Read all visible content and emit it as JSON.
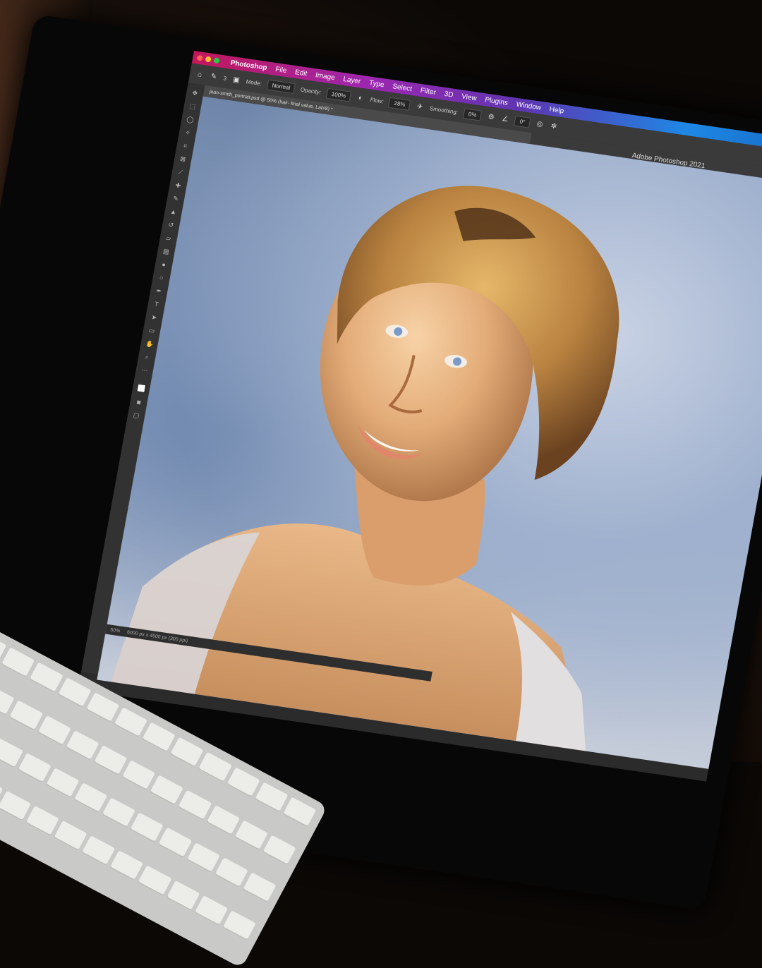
{
  "menubar": {
    "app": "Photoshop",
    "items": [
      "File",
      "Edit",
      "Image",
      "Layer",
      "Type",
      "Select",
      "Filter",
      "3D",
      "View",
      "Plugins",
      "Window",
      "Help"
    ]
  },
  "options": {
    "brush_size": "3",
    "mode_label": "Mode:",
    "mode_value": "Normal",
    "opacity_label": "Opacity:",
    "opacity_value": "100%",
    "flow_label": "Flow:",
    "flow_value": "28%",
    "smoothing_label": "Smoothing:",
    "smoothing_value": "0%",
    "angle_value": "0°"
  },
  "window_title": "Adobe Photoshop 2021",
  "document_tab": "jean-smith_portrait.psd @ 50% (hair- final value, Lab/8) *",
  "statusbar": {
    "zoom": "50%",
    "dimensions": "6000 px x 4500 px (300 ppi)"
  },
  "colors": {
    "accent_start": "#c2185b",
    "accent_end": "#1565c0",
    "ui_dark": "#2b2b2b"
  },
  "tools": [
    "move-icon",
    "marquee-icon",
    "lasso-icon",
    "quick-select-icon",
    "crop-icon",
    "frame-icon",
    "eyedropper-icon",
    "healing-icon",
    "brush-icon",
    "stamp-icon",
    "history-brush-icon",
    "eraser-icon",
    "gradient-icon",
    "blur-icon",
    "dodge-icon",
    "pen-icon",
    "type-icon",
    "path-select-icon",
    "rectangle-icon",
    "hand-icon",
    "zoom-icon"
  ]
}
